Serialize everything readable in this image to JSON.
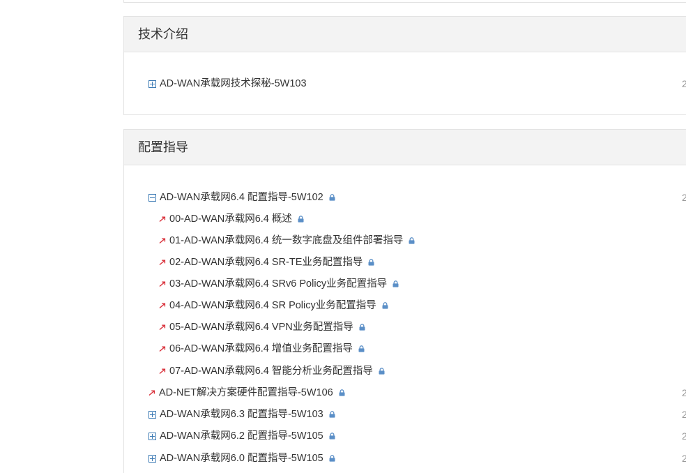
{
  "sections": [
    {
      "title": "技术介绍",
      "items": [
        {
          "label": "AD-WAN承载网技术探秘-5W103",
          "date": "2",
          "toggle": "expand",
          "locked": false
        }
      ]
    },
    {
      "title": "配置指导",
      "items": [
        {
          "label": "AD-WAN承载网6.4 配置指导-5W102",
          "date": "2",
          "toggle": "collapse",
          "locked": true
        },
        {
          "label": "00-AD-WAN承载网6.4 概述",
          "locked": true,
          "child": true
        },
        {
          "label": "01-AD-WAN承载网6.4 统一数字底盘及组件部署指导",
          "locked": true,
          "child": true
        },
        {
          "label": "02-AD-WAN承载网6.4 SR-TE业务配置指导",
          "locked": true,
          "child": true
        },
        {
          "label": "03-AD-WAN承载网6.4 SRv6 Policy业务配置指导",
          "locked": true,
          "child": true
        },
        {
          "label": "04-AD-WAN承载网6.4 SR Policy业务配置指导",
          "locked": true,
          "child": true
        },
        {
          "label": "05-AD-WAN承载网6.4 VPN业务配置指导",
          "locked": true,
          "child": true
        },
        {
          "label": "06-AD-WAN承载网6.4 增值业务配置指导",
          "locked": true,
          "child": true
        },
        {
          "label": "07-AD-WAN承载网6.4 智能分析业务配置指导",
          "locked": true,
          "child": true
        },
        {
          "label": "AD-NET解决方案硬件配置指导-5W106",
          "date": "2",
          "toggle": "arrow",
          "locked": true
        },
        {
          "label": "AD-WAN承载网6.3 配置指导-5W103",
          "date": "2",
          "toggle": "expand",
          "locked": true
        },
        {
          "label": "AD-WAN承载网6.2 配置指导-5W105",
          "date": "2",
          "toggle": "expand",
          "locked": true
        },
        {
          "label": "AD-WAN承载网6.0 配置指导-5W105",
          "date": "2",
          "toggle": "expand",
          "locked": true
        }
      ]
    }
  ],
  "colors": {
    "toggle": "#3c7ab4",
    "arrow": "#d9303a",
    "lock": "#5b8fc7",
    "header_bg": "#f3f3f3",
    "border": "#e3e3e3"
  },
  "icons": {
    "expand": "plus-box-icon",
    "collapse": "minus-box-icon",
    "arrow": "red-arrow-icon",
    "lock": "lock-icon"
  }
}
